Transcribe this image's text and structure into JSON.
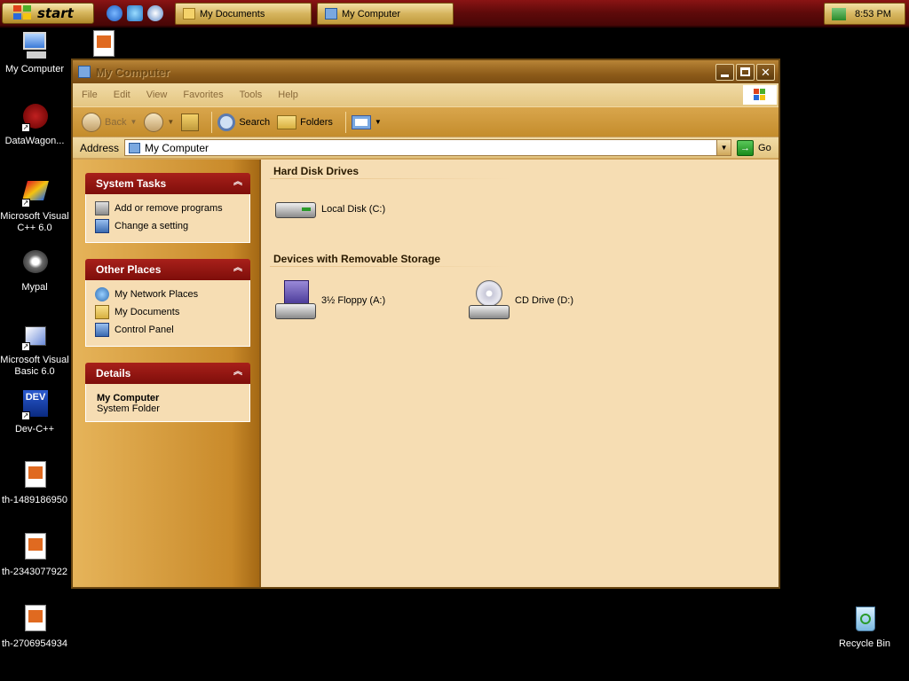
{
  "taskbar": {
    "start_label": "start",
    "tasks": [
      {
        "label": "My Documents"
      },
      {
        "label": "My Computer"
      }
    ],
    "clock": "8:53 PM"
  },
  "desktop": {
    "icons": [
      {
        "label": "My Computer"
      },
      {
        "label": "DataWagon..."
      },
      {
        "label": "Microsoft Visual C++ 6.0"
      },
      {
        "label": "Mypal"
      },
      {
        "label": "Microsoft Visual Basic 6.0"
      },
      {
        "label": "Dev-C++"
      },
      {
        "label": "th-1489186950"
      },
      {
        "label": "th-2343077922"
      },
      {
        "label": "th-2706954934"
      },
      {
        "label": "Recycle Bin"
      }
    ]
  },
  "window": {
    "title": "My Computer",
    "menu": [
      "File",
      "Edit",
      "View",
      "Favorites",
      "Tools",
      "Help"
    ],
    "toolbar": {
      "back": "Back",
      "search": "Search",
      "folders": "Folders"
    },
    "address": {
      "label": "Address",
      "value": "My Computer",
      "go": "Go"
    },
    "system_tasks": {
      "title": "System Tasks",
      "items": [
        "Add or remove programs",
        "Change a setting"
      ]
    },
    "other_places": {
      "title": "Other Places",
      "items": [
        "My Network Places",
        "My Documents",
        "Control Panel"
      ]
    },
    "details": {
      "title": "Details",
      "name": "My Computer",
      "type": "System Folder"
    },
    "hard_disk": {
      "title": "Hard Disk Drives",
      "drives": [
        "Local Disk (C:)"
      ]
    },
    "removable": {
      "title": "Devices with Removable Storage",
      "drives": [
        "3½ Floppy (A:)",
        "CD Drive (D:)"
      ]
    }
  }
}
